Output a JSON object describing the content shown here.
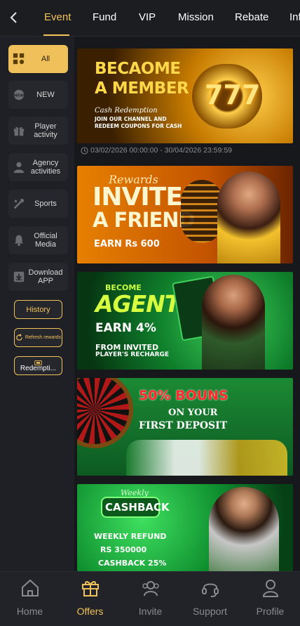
{
  "nav": {
    "tabs": [
      {
        "label": "Event",
        "active": true
      },
      {
        "label": "Fund",
        "active": false
      },
      {
        "label": "VIP",
        "active": false
      },
      {
        "label": "Mission",
        "active": false
      },
      {
        "label": "Rebate",
        "active": false
      },
      {
        "label": "Inf",
        "active": false
      }
    ]
  },
  "sidebar": {
    "items": [
      {
        "label": "All",
        "icon": "grid-cards-icon",
        "active": true
      },
      {
        "label": "NEW",
        "icon": "new-badge-icon",
        "active": false
      },
      {
        "label": "Player activity",
        "icon": "gift-icon",
        "active": false
      },
      {
        "label": "Agency activities",
        "icon": "agent-person-icon",
        "active": false
      },
      {
        "label": "Sports",
        "icon": "sports-icon",
        "active": false
      },
      {
        "label": "Official Media",
        "icon": "bell-icon",
        "active": false
      },
      {
        "label": "Download APP",
        "icon": "download-icon",
        "active": false
      }
    ],
    "history_label": "History",
    "refresh_label": "Refresh rewards",
    "redeem_label": "Redempti..."
  },
  "banners": [
    {
      "name": "become-member-banner",
      "line1": "BECAOME",
      "line2": "A MEMBER",
      "sub_script": "Cash Redemption",
      "sub1": "JOIN OUR CHANNEL AND",
      "sub2": "REDEEM COUPONS FOR CASH",
      "badge": "777"
    },
    {
      "name": "invite-friend-banner",
      "script": "Rewards",
      "line1": "INVITE",
      "line2": "A FRIEND",
      "sub": "EARN Rs 600"
    },
    {
      "name": "become-agent-banner",
      "small": "BECOME",
      "big": "AGENT",
      "earn": "EARN 4%",
      "sub1": "FROM INVITED",
      "sub2": "PLAYER'S RECHARGE"
    },
    {
      "name": "first-deposit-bonus-banner",
      "big": "50% BOUNS",
      "sub1": "ON YOUR",
      "sub2": "FIRST DEPOSIT"
    },
    {
      "name": "weekly-cashback-banner",
      "script": "Weekly",
      "big": "CASHBACK",
      "sub1": "WEEKLY REFUND",
      "sub2": "RS 350000",
      "sub3": "CASHBACK 25%"
    }
  ],
  "event_date_range": "03/02/2026 00:00:00 - 30/04/2026 23:59:59",
  "bottom_nav": [
    {
      "label": "Home",
      "icon": "home-icon",
      "active": false
    },
    {
      "label": "Offers",
      "icon": "gift-icon",
      "active": true
    },
    {
      "label": "Invite",
      "icon": "invite-people-icon",
      "active": false
    },
    {
      "label": "Support",
      "icon": "headset-icon",
      "active": false
    },
    {
      "label": "Profile",
      "icon": "person-icon",
      "active": false
    }
  ],
  "colors": {
    "accent": "#f0c15a",
    "background": "#17181c",
    "panel": "#26272c"
  }
}
